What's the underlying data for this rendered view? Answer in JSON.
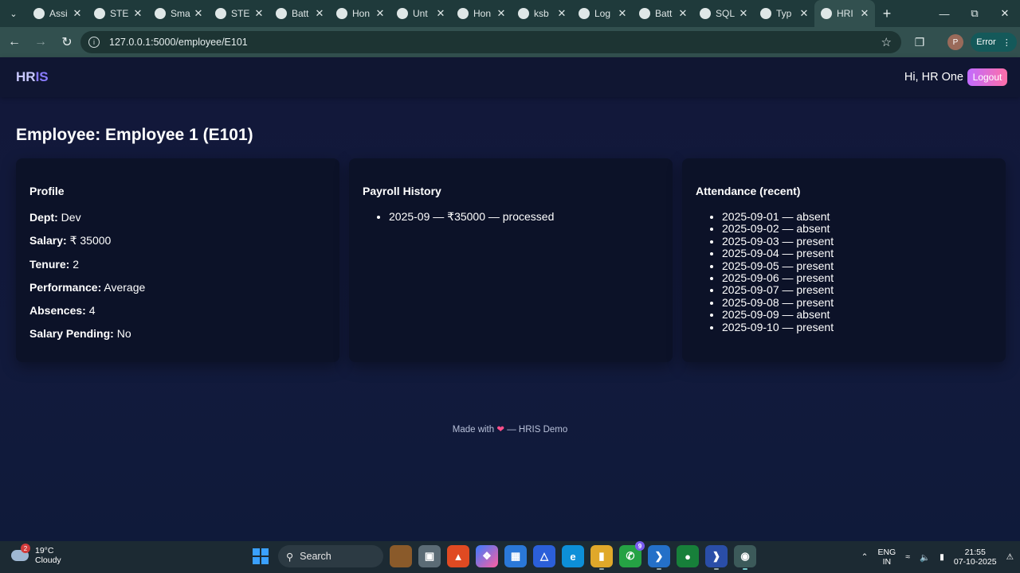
{
  "browser": {
    "tabs": [
      {
        "label": "Assi",
        "icon": "y-icon"
      },
      {
        "label": "STE",
        "icon": "globe-icon"
      },
      {
        "label": "Sma",
        "icon": "map-pin-icon"
      },
      {
        "label": "STE",
        "icon": "globe-icon"
      },
      {
        "label": "Batt",
        "icon": "globe-icon"
      },
      {
        "label": "Hon",
        "icon": "globe-icon"
      },
      {
        "label": "Unt",
        "icon": "globe-icon"
      },
      {
        "label": "Hon",
        "icon": "arc-icon"
      },
      {
        "label": "ksb",
        "icon": "globe-icon"
      },
      {
        "label": "Log",
        "icon": "c-icon"
      },
      {
        "label": "Batt",
        "icon": "globe-icon"
      },
      {
        "label": "SQL",
        "icon": "openai-icon"
      },
      {
        "label": "Typ",
        "icon": "window-icon"
      },
      {
        "label": "HRI",
        "icon": "globe-icon",
        "active": true
      }
    ],
    "url": "127.0.0.1:5000/employee/E101",
    "profile_initial": "P",
    "error_label": "Error"
  },
  "app": {
    "brand_part1": "HR",
    "brand_part2": "IS",
    "greeting": "Hi, HR One",
    "logout_label": "Logout"
  },
  "page": {
    "title": "Employee: Employee 1 (E101)",
    "profile": {
      "heading": "Profile",
      "fields": [
        {
          "label": "Dept:",
          "value": "Dev"
        },
        {
          "label": "Salary:",
          "value": "₹ 35000"
        },
        {
          "label": "Tenure:",
          "value": "2"
        },
        {
          "label": "Performance:",
          "value": "Average"
        },
        {
          "label": "Absences:",
          "value": "4"
        },
        {
          "label": "Salary Pending:",
          "value": "No"
        }
      ]
    },
    "payroll": {
      "heading": "Payroll History",
      "items": [
        "2025-09 — ₹35000 — processed"
      ]
    },
    "attendance": {
      "heading": "Attendance (recent)",
      "items": [
        "2025-09-01 — absent",
        "2025-09-02 — absent",
        "2025-09-03 — present",
        "2025-09-04 — present",
        "2025-09-05 — present",
        "2025-09-06 — present",
        "2025-09-07 — present",
        "2025-09-08 — present",
        "2025-09-09 — absent",
        "2025-09-10 — present"
      ]
    },
    "footer": {
      "before": "Made with",
      "after": "— HRIS Demo"
    }
  },
  "taskbar": {
    "weather_temp": "19°C",
    "weather_desc": "Cloudy",
    "weather_badge": "2",
    "search_label": "Search",
    "lang_line1": "ENG",
    "lang_line2": "IN",
    "time": "21:55",
    "date": "07-10-2025",
    "whatsapp_badge": "9"
  },
  "colors": {
    "accent": "#8a7cff",
    "logout_gradient_start": "#c16bff",
    "logout_gradient_end": "#ff6fa8",
    "page_bg": "#12183a",
    "card_bg": "#0c1228"
  }
}
